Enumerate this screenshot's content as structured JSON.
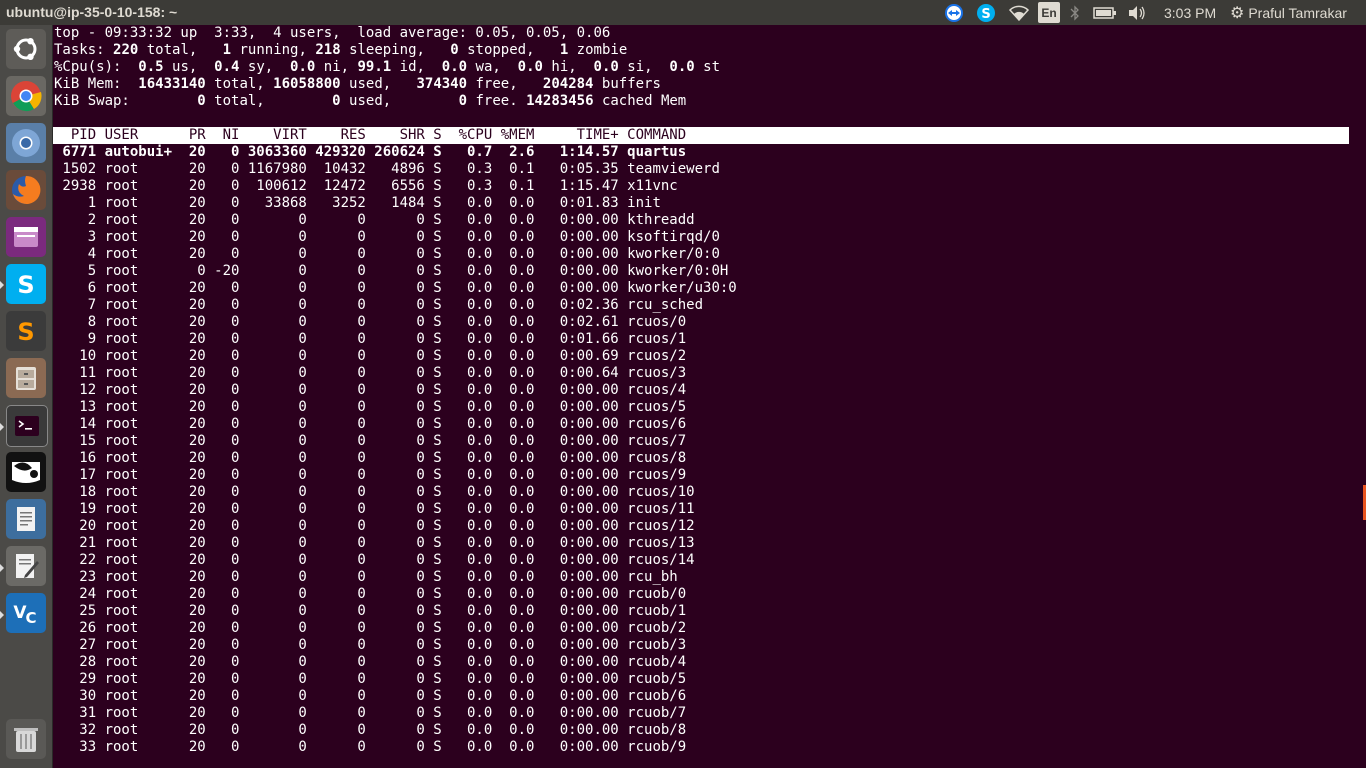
{
  "window": {
    "title": "ubuntu@ip-35-0-10-158: ~"
  },
  "panel": {
    "keyboard_layout": "En",
    "clock": "3:03 PM",
    "user": "Praful Tamrakar",
    "icons": [
      "teamviewer-icon",
      "skype-icon",
      "wifi-icon",
      "keyboard-icon",
      "bluetooth-icon",
      "battery-icon",
      "volume-icon",
      "gear-icon"
    ]
  },
  "launcher": {
    "items": [
      "ubuntu-dash",
      "chromium",
      "chrome",
      "firefox",
      "app-window",
      "skype",
      "sublime-text",
      "files",
      "terminal",
      "eye-app",
      "document-viewer",
      "text-editor",
      "vnc-viewer",
      "trash"
    ]
  },
  "summary": {
    "line1": "top - 09:33:32 up  3:33,  4 users,  load average: 0.05, 0.05, 0.06",
    "l2a": "Tasks: ",
    "l2b": "220",
    "l2c": " total,   ",
    "l2d": "1",
    "l2e": " running, ",
    "l2f": "218",
    "l2g": " sleeping,   ",
    "l2h": "0",
    "l2i": " stopped,   ",
    "l2j": "1",
    "l2k": " zombie",
    "l3a": "%Cpu(s):  ",
    "l3b": "0.5",
    "l3c": " us,  ",
    "l3d": "0.4",
    "l3e": " sy,  ",
    "l3f": "0.0",
    "l3g": " ni, ",
    "l3h": "99.1",
    "l3i": " id,  ",
    "l3j": "0.0",
    "l3k": " wa,  ",
    "l3l": "0.0",
    "l3m": " hi,  ",
    "l3n": "0.0",
    "l3o": " si,  ",
    "l3p": "0.0",
    "l3q": " st",
    "l4a": "KiB Mem:  ",
    "l4b": "16433140",
    "l4c": " total, ",
    "l4d": "16058800",
    "l4e": " used,   ",
    "l4f": "374340",
    "l4g": " free,   ",
    "l4h": "204284",
    "l4i": " buffers",
    "l5a": "KiB Swap:        ",
    "l5b": "0",
    "l5c": " total,        ",
    "l5d": "0",
    "l5e": " used,        ",
    "l5f": "0",
    "l5g": " free. ",
    "l5h": "14283456",
    "l5i": " cached Mem"
  },
  "table": {
    "header": "  PID USER      PR  NI    VIRT    RES    SHR S  %CPU %MEM     TIME+ COMMAND",
    "rows": [
      " 6771 autobui+  20   0 3063360 429320 260624 S   0.7  2.6   1:14.57 quartus",
      " 1502 root      20   0 1167980  10432   4896 S   0.3  0.1   0:05.35 teamviewerd",
      " 2938 root      20   0  100612  12472   6556 S   0.3  0.1   1:15.47 x11vnc",
      "    1 root      20   0   33868   3252   1484 S   0.0  0.0   0:01.83 init",
      "    2 root      20   0       0      0      0 S   0.0  0.0   0:00.00 kthreadd",
      "    3 root      20   0       0      0      0 S   0.0  0.0   0:00.00 ksoftirqd/0",
      "    4 root      20   0       0      0      0 S   0.0  0.0   0:00.00 kworker/0:0",
      "    5 root       0 -20       0      0      0 S   0.0  0.0   0:00.00 kworker/0:0H",
      "    6 root      20   0       0      0      0 S   0.0  0.0   0:00.00 kworker/u30:0",
      "    7 root      20   0       0      0      0 S   0.0  0.0   0:02.36 rcu_sched",
      "    8 root      20   0       0      0      0 S   0.0  0.0   0:02.61 rcuos/0",
      "    9 root      20   0       0      0      0 S   0.0  0.0   0:01.66 rcuos/1",
      "   10 root      20   0       0      0      0 S   0.0  0.0   0:00.69 rcuos/2",
      "   11 root      20   0       0      0      0 S   0.0  0.0   0:00.64 rcuos/3",
      "   12 root      20   0       0      0      0 S   0.0  0.0   0:00.00 rcuos/4",
      "   13 root      20   0       0      0      0 S   0.0  0.0   0:00.00 rcuos/5",
      "   14 root      20   0       0      0      0 S   0.0  0.0   0:00.00 rcuos/6",
      "   15 root      20   0       0      0      0 S   0.0  0.0   0:00.00 rcuos/7",
      "   16 root      20   0       0      0      0 S   0.0  0.0   0:00.00 rcuos/8",
      "   17 root      20   0       0      0      0 S   0.0  0.0   0:00.00 rcuos/9",
      "   18 root      20   0       0      0      0 S   0.0  0.0   0:00.00 rcuos/10",
      "   19 root      20   0       0      0      0 S   0.0  0.0   0:00.00 rcuos/11",
      "   20 root      20   0       0      0      0 S   0.0  0.0   0:00.00 rcuos/12",
      "   21 root      20   0       0      0      0 S   0.0  0.0   0:00.00 rcuos/13",
      "   22 root      20   0       0      0      0 S   0.0  0.0   0:00.00 rcuos/14",
      "   23 root      20   0       0      0      0 S   0.0  0.0   0:00.00 rcu_bh",
      "   24 root      20   0       0      0      0 S   0.0  0.0   0:00.00 rcuob/0",
      "   25 root      20   0       0      0      0 S   0.0  0.0   0:00.00 rcuob/1",
      "   26 root      20   0       0      0      0 S   0.0  0.0   0:00.00 rcuob/2",
      "   27 root      20   0       0      0      0 S   0.0  0.0   0:00.00 rcuob/3",
      "   28 root      20   0       0      0      0 S   0.0  0.0   0:00.00 rcuob/4",
      "   29 root      20   0       0      0      0 S   0.0  0.0   0:00.00 rcuob/5",
      "   30 root      20   0       0      0      0 S   0.0  0.0   0:00.00 rcuob/6",
      "   31 root      20   0       0      0      0 S   0.0  0.0   0:00.00 rcuob/7",
      "   32 root      20   0       0      0      0 S   0.0  0.0   0:00.00 rcuob/8",
      "   33 root      20   0       0      0      0 S   0.0  0.0   0:00.00 rcuob/9"
    ]
  },
  "colors": {
    "terminal_bg": "#2c001e",
    "panel_bg": "#3c3b37",
    "launcher_bg": "#4b4a47"
  }
}
